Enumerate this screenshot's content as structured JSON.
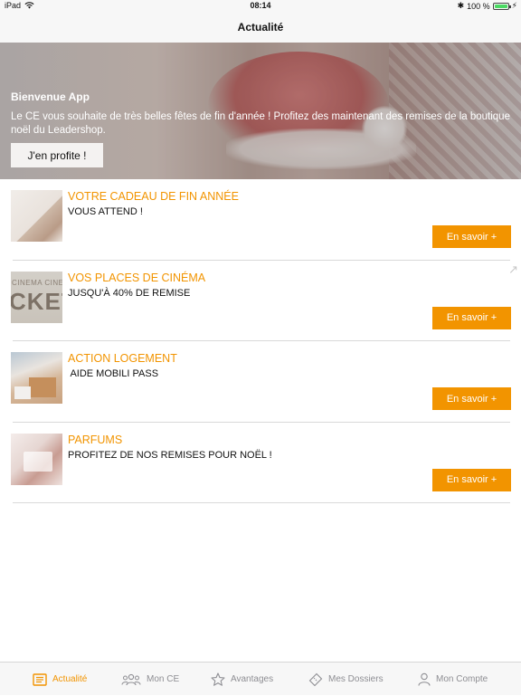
{
  "status_bar": {
    "device": "iPad",
    "time": "08:14",
    "battery": "100 %",
    "bluetooth_glyph": "✱",
    "charging_glyph": "⚡"
  },
  "nav": {
    "title": "Actualité"
  },
  "hero": {
    "title": "Bienvenue App",
    "text": "Le CE vous souhaite de très belles fêtes de fin d'année ! Profitez des maintenant des remises de la boutique noël du Leadershop.",
    "cta_label": "J'en profite !"
  },
  "feed": {
    "items": [
      {
        "title": "VOTRE CADEAU DE FIN ANNÉE",
        "subtitle": "VOUS ATTEND !",
        "button": "En savoir +"
      },
      {
        "title": "VOS PLACES DE CINÉMA",
        "subtitle": "JUSQU'À 40% DE REMISE",
        "button": "En savoir +",
        "thumb_text_top": "CINEMA CINE",
        "thumb_text_big": "CKET"
      },
      {
        "title": "ACTION LOGEMENT",
        "subtitle": " AIDE MOBILI PASS",
        "button": "En savoir +"
      },
      {
        "title": "PARFUMS",
        "subtitle": "PROFITEZ DE NOS REMISES POUR NOËL !",
        "button": "En savoir +"
      }
    ],
    "corner_glyph": "↗"
  },
  "tabs": [
    {
      "label": "Actualité",
      "icon": "news-icon",
      "active": true
    },
    {
      "label": "Mon CE",
      "icon": "group-icon",
      "active": false
    },
    {
      "label": "Avantages",
      "icon": "star-icon",
      "active": false
    },
    {
      "label": "Mes Dossiers",
      "icon": "ticket-icon",
      "active": false
    },
    {
      "label": "Mon Compte",
      "icon": "user-icon",
      "active": false
    }
  ],
  "colors": {
    "accent": "#f29400",
    "inactive_tab": "#8e8e93",
    "bar_background": "#f7f7f7",
    "battery": "#4cd964"
  }
}
